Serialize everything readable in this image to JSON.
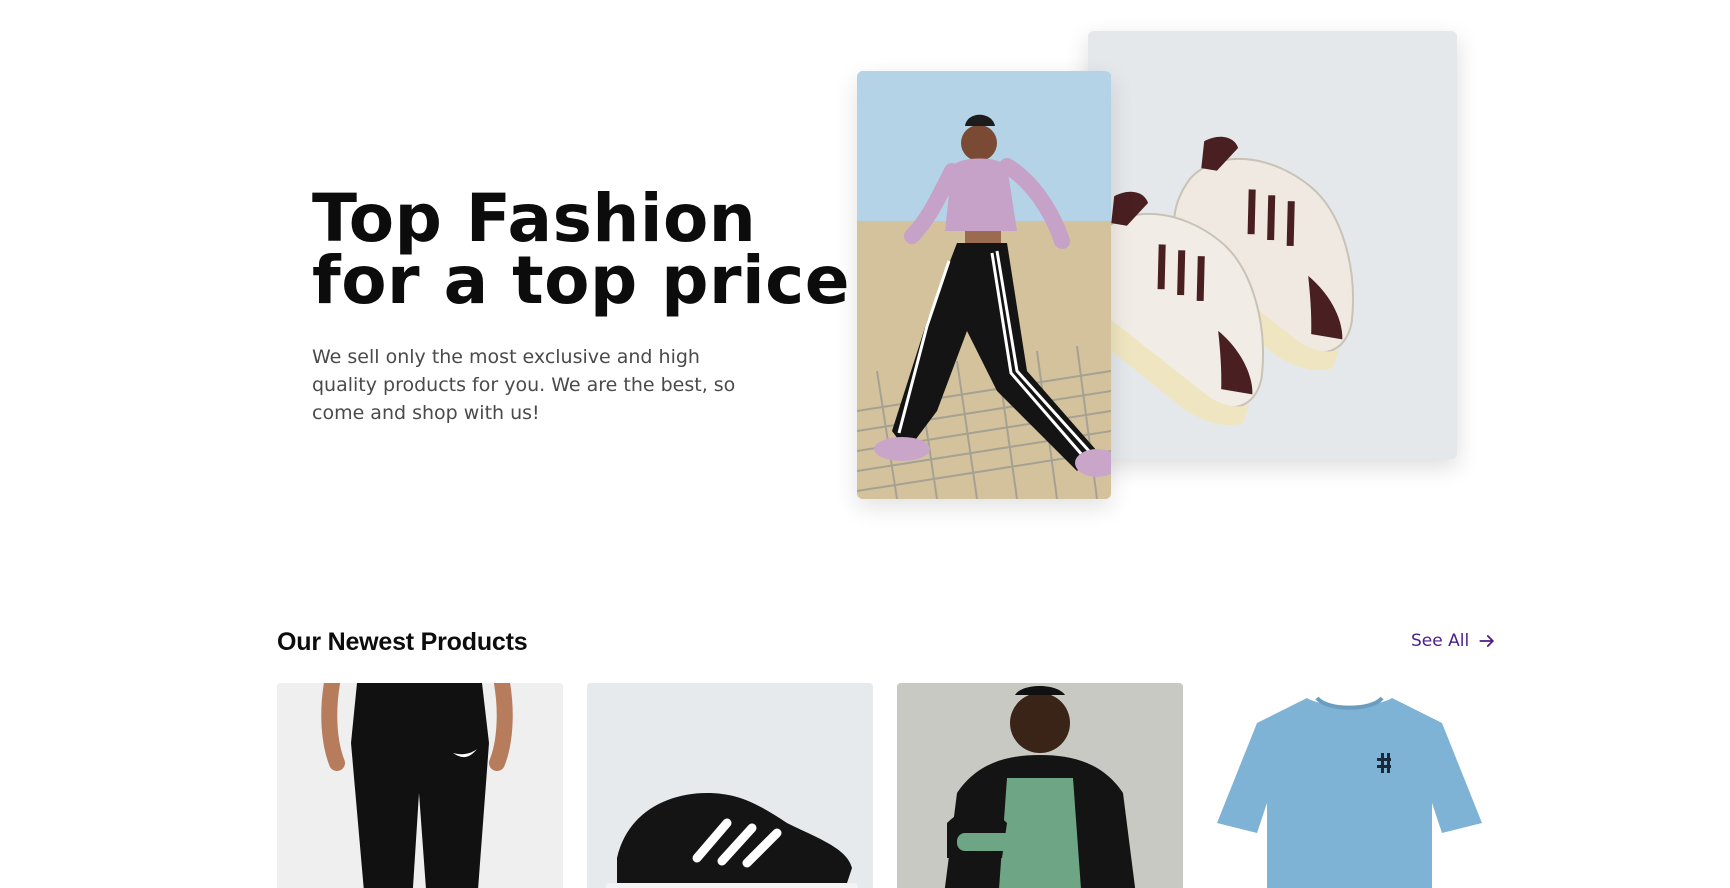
{
  "hero": {
    "title_line1": "Top Fashion",
    "title_line2": "for a top price",
    "description": "We sell only the most exclusive and high quality products for you. We are the best, so come and shop with us!",
    "image_left": "woman-in-tracksuit-photo",
    "image_right": "sneakers-photo"
  },
  "newest": {
    "title": "Our Newest Products",
    "see_all_label": "See All",
    "see_all_icon": "arrow-right-icon",
    "products": [
      {
        "image": "black-track-pants-photo"
      },
      {
        "image": "black-running-shoe-photo"
      },
      {
        "image": "green-black-jacket-photo"
      },
      {
        "image": "light-blue-tshirt-photo"
      }
    ]
  },
  "colors": {
    "accent": "#4b1d8a",
    "heading": "#0c0c0c",
    "body_text": "#4a4a4a",
    "card_bg": "#e4e8ea"
  }
}
